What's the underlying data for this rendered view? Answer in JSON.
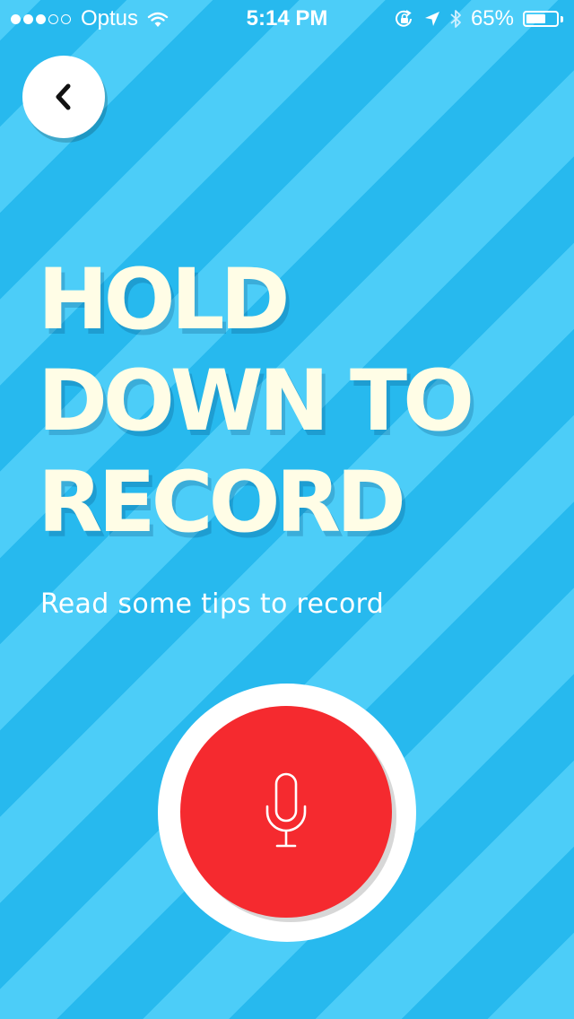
{
  "status_bar": {
    "carrier": "Optus",
    "time": "5:14 PM",
    "battery_percent_label": "65%",
    "battery_level": 0.65,
    "signal_bars_filled": 3,
    "signal_bars_total": 5
  },
  "back_button": {
    "icon": "chevron-left-icon"
  },
  "headline": {
    "line1": "HOLD",
    "line2": "DOWN TO",
    "line3": "RECORD"
  },
  "tips_link": "Read some tips to record",
  "record_button": {
    "icon": "microphone-icon"
  },
  "colors": {
    "stripe_light": "#4ccdf8",
    "stripe_dark": "#27b9ee",
    "record_red": "#f52a2f",
    "headline_text": "#fffde6"
  }
}
